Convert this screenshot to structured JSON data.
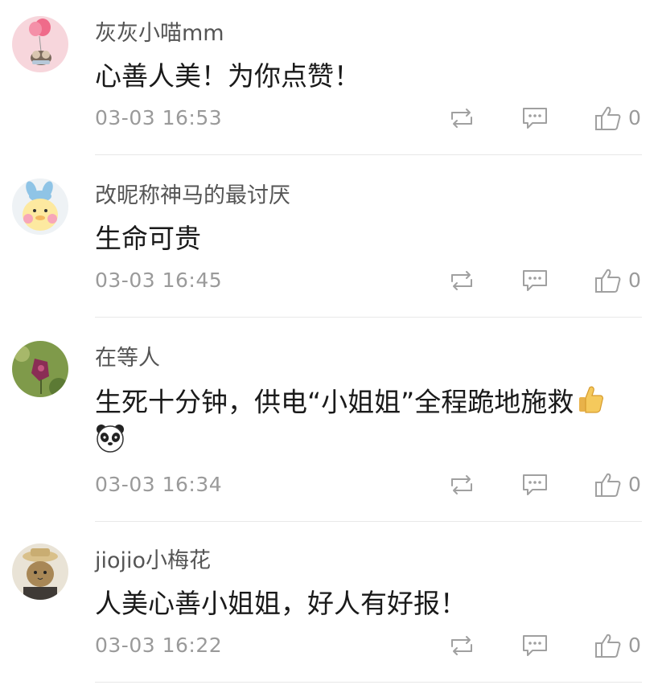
{
  "comments": [
    {
      "username": "灰灰小喵mm",
      "content": "心善人美！为你点赞！",
      "timestamp": "03-03 16:53",
      "likes": "0",
      "avatar_icon": "balloon-bear-avatar"
    },
    {
      "username": "改昵称神马的最讨厌",
      "content": "生命可贵",
      "timestamp": "03-03 16:45",
      "likes": "0",
      "avatar_icon": "duck-bunny-avatar"
    },
    {
      "username": "在等人",
      "content": "生死十分钟，供电“小姐姐”全程跪地施救",
      "emojis": [
        "thumbs-up-emoji",
        "panda-emoji"
      ],
      "timestamp": "03-03 16:34",
      "likes": "0",
      "avatar_icon": "flower-avatar"
    },
    {
      "username": "jiojio小梅花",
      "content": "人美心善小姐姐，好人有好报！",
      "timestamp": "03-03 16:22",
      "likes": "0",
      "avatar_icon": "cat-hat-avatar"
    }
  ],
  "actions": {
    "forward_icon": "forward-icon",
    "reply_icon": "comment-icon",
    "like_icon": "thumbs-up-icon"
  },
  "colors": {
    "text_primary": "#1a1a1a",
    "text_username": "#555555",
    "text_meta": "#9a9a9a",
    "divider": "#e8e8e8"
  }
}
